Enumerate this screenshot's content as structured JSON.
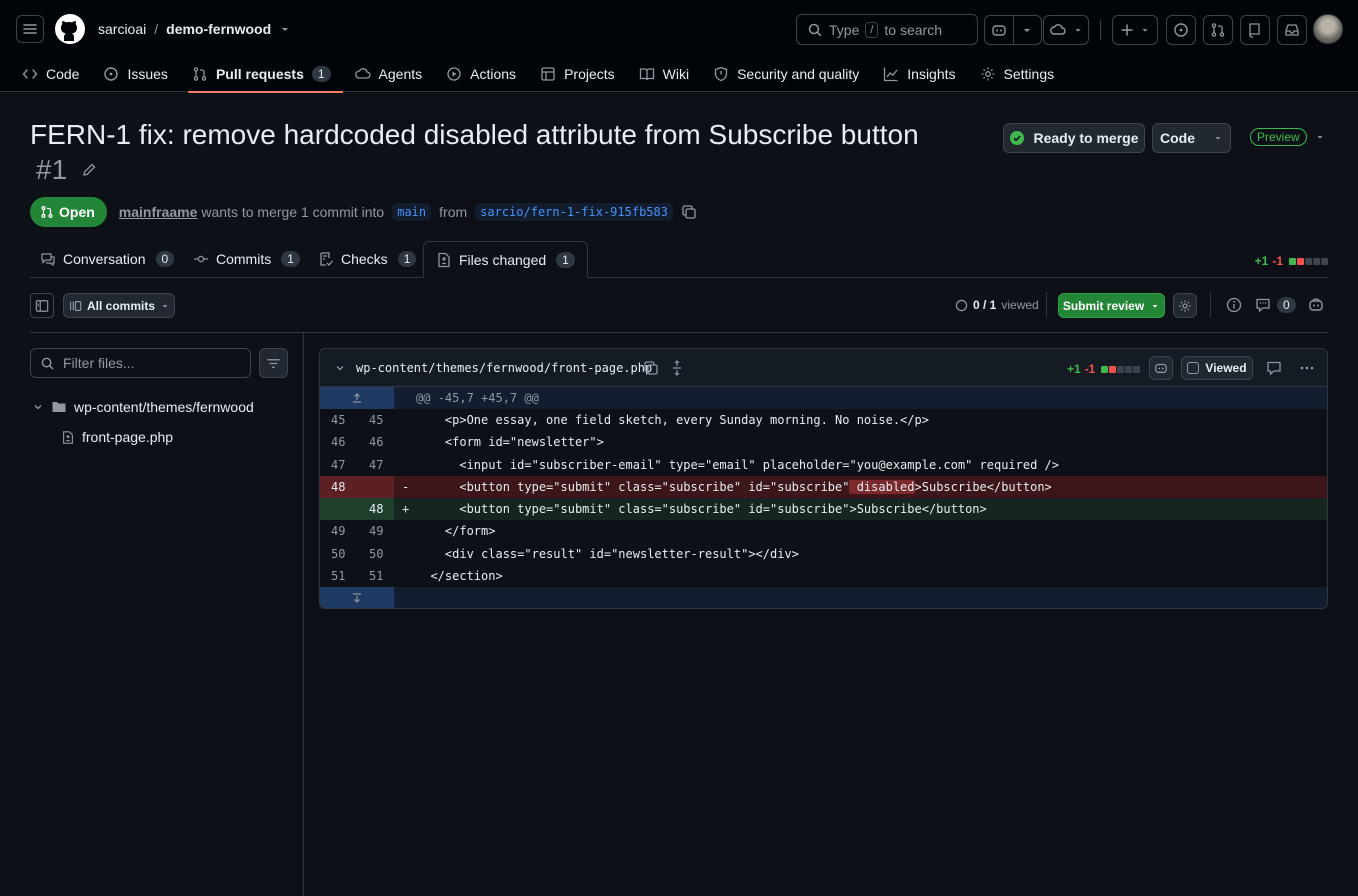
{
  "header": {
    "owner": "sarcioai",
    "separator": "/",
    "repo": "demo-fernwood",
    "search_placeholder_pre": "Type",
    "search_key": "/",
    "search_placeholder_post": "to search"
  },
  "repo_nav": [
    {
      "label": "Code",
      "icon": "code-icon"
    },
    {
      "label": "Issues",
      "icon": "issue-icon"
    },
    {
      "label": "Pull requests",
      "icon": "pull-request-icon",
      "count": "1",
      "selected": true
    },
    {
      "label": "Agents",
      "icon": "agents-icon"
    },
    {
      "label": "Actions",
      "icon": "play-icon"
    },
    {
      "label": "Projects",
      "icon": "table-icon"
    },
    {
      "label": "Wiki",
      "icon": "book-icon"
    },
    {
      "label": "Security and quality",
      "icon": "shield-icon"
    },
    {
      "label": "Insights",
      "icon": "graph-icon"
    },
    {
      "label": "Settings",
      "icon": "gear-icon"
    }
  ],
  "pr": {
    "title": "FERN-1 fix: remove hardcoded disabled attribute from Subscribe button",
    "number": "#1",
    "state": "Open",
    "author": "mainfraame",
    "merge_text": "wants to merge 1 commit into",
    "base": "main",
    "from_text": "from",
    "head": "sarcio/fern-1-fix-915fb583",
    "ready_label": "Ready to merge",
    "code_label": "Code",
    "preview_label": "Preview"
  },
  "pr_tabs": [
    {
      "label": "Conversation",
      "count": "0",
      "icon": "comment-icon"
    },
    {
      "label": "Commits",
      "count": "1",
      "icon": "commit-icon"
    },
    {
      "label": "Checks",
      "count": "1",
      "icon": "checklist-icon"
    },
    {
      "label": "Files changed",
      "count": "1",
      "icon": "file-diff-icon",
      "selected": true
    }
  ],
  "diffstat": {
    "additions": "+1",
    "deletions": "-1"
  },
  "toolbar": {
    "all_commits": "All commits",
    "viewed_count": "0 / 1",
    "viewed_suffix": "viewed",
    "submit_review": "Submit review",
    "comments_count": "0"
  },
  "file_tree": {
    "filter_placeholder": "Filter files...",
    "folder": "wp-content/themes/fernwood",
    "file": "front-page.php"
  },
  "diff": {
    "path": "wp-content/themes/fernwood/front-page.php",
    "additions": "+1",
    "deletions": "-1",
    "viewed_label": "Viewed",
    "hunk_header": "@@ -45,7 +45,7 @@",
    "lines": [
      {
        "old": "45",
        "new": "45",
        "sign": "",
        "type": "ctx",
        "code": "    <p>One essay, one field sketch, every Sunday morning. No noise.</p>"
      },
      {
        "old": "46",
        "new": "46",
        "sign": "",
        "type": "ctx",
        "code": "    <form id=\"newsletter\">"
      },
      {
        "old": "47",
        "new": "47",
        "sign": "",
        "type": "ctx",
        "code": "      <input id=\"subscriber-email\" type=\"email\" placeholder=\"you@example.com\" required />"
      },
      {
        "old": "48",
        "new": "",
        "sign": "-",
        "type": "del",
        "code_pre": "      <button type=\"submit\" class=\"subscribe\" id=\"subscribe\"",
        "code_hl": " disabled",
        "code_post": ">Subscribe</button>"
      },
      {
        "old": "",
        "new": "48",
        "sign": "+",
        "type": "add",
        "code": "      <button type=\"submit\" class=\"subscribe\" id=\"subscribe\">Subscribe</button>"
      },
      {
        "old": "49",
        "new": "49",
        "sign": "",
        "type": "ctx",
        "code": "    </form>"
      },
      {
        "old": "50",
        "new": "50",
        "sign": "",
        "type": "ctx",
        "code": "    <div class=\"result\" id=\"newsletter-result\"></div>"
      },
      {
        "old": "51",
        "new": "51",
        "sign": "",
        "type": "ctx",
        "code": "  </section>"
      }
    ]
  },
  "colors": {
    "accent_green": "#238636",
    "open_badge": "#238636",
    "link_blue": "#4493f8",
    "del_bg": "#3c1618",
    "add_bg": "#14261f",
    "hunk_bg": "#121d2f"
  }
}
